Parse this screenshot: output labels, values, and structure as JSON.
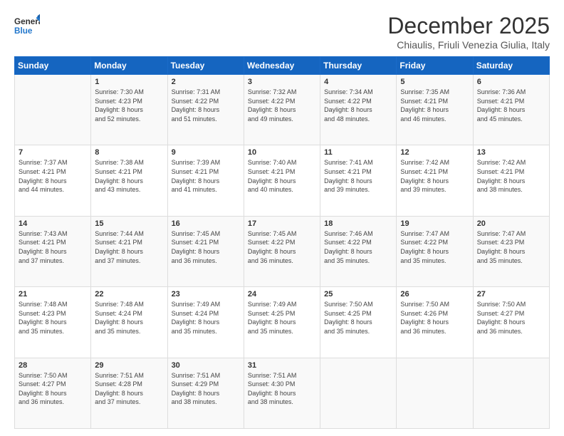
{
  "header": {
    "logo_general": "General",
    "logo_blue": "Blue",
    "title": "December 2025",
    "subtitle": "Chiaulis, Friuli Venezia Giulia, Italy"
  },
  "days_of_week": [
    "Sunday",
    "Monday",
    "Tuesday",
    "Wednesday",
    "Thursday",
    "Friday",
    "Saturday"
  ],
  "weeks": [
    [
      {
        "day": "",
        "text": ""
      },
      {
        "day": "1",
        "text": "Sunrise: 7:30 AM\nSunset: 4:23 PM\nDaylight: 8 hours\nand 52 minutes."
      },
      {
        "day": "2",
        "text": "Sunrise: 7:31 AM\nSunset: 4:22 PM\nDaylight: 8 hours\nand 51 minutes."
      },
      {
        "day": "3",
        "text": "Sunrise: 7:32 AM\nSunset: 4:22 PM\nDaylight: 8 hours\nand 49 minutes."
      },
      {
        "day": "4",
        "text": "Sunrise: 7:34 AM\nSunset: 4:22 PM\nDaylight: 8 hours\nand 48 minutes."
      },
      {
        "day": "5",
        "text": "Sunrise: 7:35 AM\nSunset: 4:21 PM\nDaylight: 8 hours\nand 46 minutes."
      },
      {
        "day": "6",
        "text": "Sunrise: 7:36 AM\nSunset: 4:21 PM\nDaylight: 8 hours\nand 45 minutes."
      }
    ],
    [
      {
        "day": "7",
        "text": "Sunrise: 7:37 AM\nSunset: 4:21 PM\nDaylight: 8 hours\nand 44 minutes."
      },
      {
        "day": "8",
        "text": "Sunrise: 7:38 AM\nSunset: 4:21 PM\nDaylight: 8 hours\nand 43 minutes."
      },
      {
        "day": "9",
        "text": "Sunrise: 7:39 AM\nSunset: 4:21 PM\nDaylight: 8 hours\nand 41 minutes."
      },
      {
        "day": "10",
        "text": "Sunrise: 7:40 AM\nSunset: 4:21 PM\nDaylight: 8 hours\nand 40 minutes."
      },
      {
        "day": "11",
        "text": "Sunrise: 7:41 AM\nSunset: 4:21 PM\nDaylight: 8 hours\nand 39 minutes."
      },
      {
        "day": "12",
        "text": "Sunrise: 7:42 AM\nSunset: 4:21 PM\nDaylight: 8 hours\nand 39 minutes."
      },
      {
        "day": "13",
        "text": "Sunrise: 7:42 AM\nSunset: 4:21 PM\nDaylight: 8 hours\nand 38 minutes."
      }
    ],
    [
      {
        "day": "14",
        "text": "Sunrise: 7:43 AM\nSunset: 4:21 PM\nDaylight: 8 hours\nand 37 minutes."
      },
      {
        "day": "15",
        "text": "Sunrise: 7:44 AM\nSunset: 4:21 PM\nDaylight: 8 hours\nand 37 minutes."
      },
      {
        "day": "16",
        "text": "Sunrise: 7:45 AM\nSunset: 4:21 PM\nDaylight: 8 hours\nand 36 minutes."
      },
      {
        "day": "17",
        "text": "Sunrise: 7:45 AM\nSunset: 4:22 PM\nDaylight: 8 hours\nand 36 minutes."
      },
      {
        "day": "18",
        "text": "Sunrise: 7:46 AM\nSunset: 4:22 PM\nDaylight: 8 hours\nand 35 minutes."
      },
      {
        "day": "19",
        "text": "Sunrise: 7:47 AM\nSunset: 4:22 PM\nDaylight: 8 hours\nand 35 minutes."
      },
      {
        "day": "20",
        "text": "Sunrise: 7:47 AM\nSunset: 4:23 PM\nDaylight: 8 hours\nand 35 minutes."
      }
    ],
    [
      {
        "day": "21",
        "text": "Sunrise: 7:48 AM\nSunset: 4:23 PM\nDaylight: 8 hours\nand 35 minutes."
      },
      {
        "day": "22",
        "text": "Sunrise: 7:48 AM\nSunset: 4:24 PM\nDaylight: 8 hours\nand 35 minutes."
      },
      {
        "day": "23",
        "text": "Sunrise: 7:49 AM\nSunset: 4:24 PM\nDaylight: 8 hours\nand 35 minutes."
      },
      {
        "day": "24",
        "text": "Sunrise: 7:49 AM\nSunset: 4:25 PM\nDaylight: 8 hours\nand 35 minutes."
      },
      {
        "day": "25",
        "text": "Sunrise: 7:50 AM\nSunset: 4:25 PM\nDaylight: 8 hours\nand 35 minutes."
      },
      {
        "day": "26",
        "text": "Sunrise: 7:50 AM\nSunset: 4:26 PM\nDaylight: 8 hours\nand 36 minutes."
      },
      {
        "day": "27",
        "text": "Sunrise: 7:50 AM\nSunset: 4:27 PM\nDaylight: 8 hours\nand 36 minutes."
      }
    ],
    [
      {
        "day": "28",
        "text": "Sunrise: 7:50 AM\nSunset: 4:27 PM\nDaylight: 8 hours\nand 36 minutes."
      },
      {
        "day": "29",
        "text": "Sunrise: 7:51 AM\nSunset: 4:28 PM\nDaylight: 8 hours\nand 37 minutes."
      },
      {
        "day": "30",
        "text": "Sunrise: 7:51 AM\nSunset: 4:29 PM\nDaylight: 8 hours\nand 38 minutes."
      },
      {
        "day": "31",
        "text": "Sunrise: 7:51 AM\nSunset: 4:30 PM\nDaylight: 8 hours\nand 38 minutes."
      },
      {
        "day": "",
        "text": ""
      },
      {
        "day": "",
        "text": ""
      },
      {
        "day": "",
        "text": ""
      }
    ]
  ]
}
